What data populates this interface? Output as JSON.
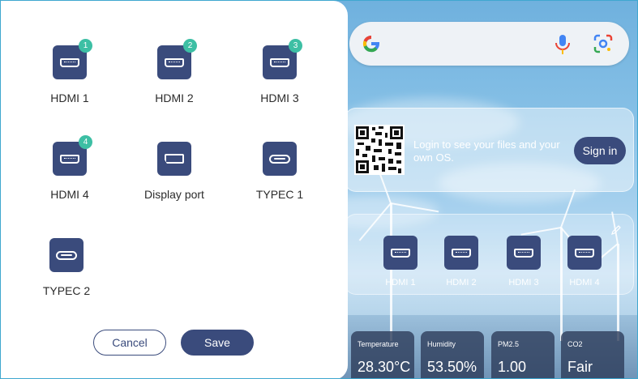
{
  "panel": {
    "sources": [
      {
        "label": "HDMI 1",
        "badge": "1",
        "port": "hdmi"
      },
      {
        "label": "HDMI 2",
        "badge": "2",
        "port": "hdmi"
      },
      {
        "label": "HDMI 3",
        "badge": "3",
        "port": "hdmi"
      },
      {
        "label": "HDMI 4",
        "badge": "4",
        "port": "hdmi"
      },
      {
        "label": "Display port",
        "badge": "",
        "port": "displayport"
      },
      {
        "label": "TYPEC 1",
        "badge": "",
        "port": "usb-c"
      },
      {
        "label": "TYPEC 2",
        "badge": "",
        "port": "usb-c"
      }
    ],
    "cancel_label": "Cancel",
    "save_label": "Save"
  },
  "search": {
    "logo": "G",
    "icons": [
      "google-logo-icon",
      "mic-icon",
      "lens-icon"
    ]
  },
  "signin": {
    "message": "Login to see your files and your own OS.",
    "button_label": "Sign in"
  },
  "sources_widget": {
    "items": [
      "HDMI 1",
      "HDMI 2",
      "HDMI 3",
      "HDMI 4"
    ]
  },
  "sensors": [
    {
      "label": "Temperature",
      "value": "28.30°C"
    },
    {
      "label": "Humidity",
      "value": "53.50%"
    },
    {
      "label": "PM2.5",
      "value": "1.00"
    },
    {
      "label": "CO2",
      "value": "Fair"
    }
  ],
  "colors": {
    "accent": "#3a4b7c",
    "badge": "#3dbfa4",
    "frame": "#3fa7cf"
  }
}
